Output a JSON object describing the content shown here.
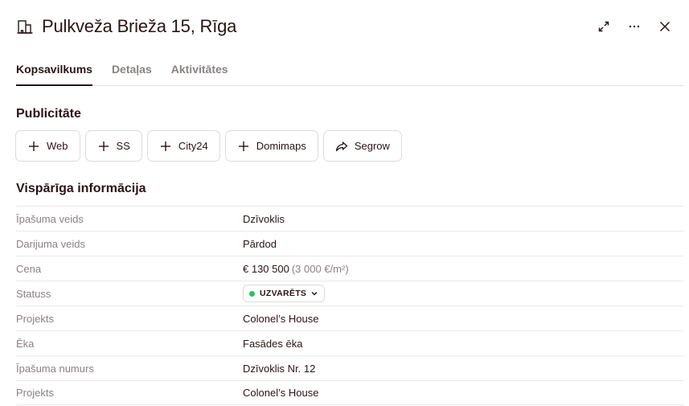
{
  "header": {
    "title": "Pulkveža Brieža 15, Rīga",
    "title_icon": "building-icon",
    "actions": [
      "expand-icon",
      "more-icon",
      "close-icon"
    ]
  },
  "tabs": [
    {
      "label": "Kopsavilkums",
      "active": true
    },
    {
      "label": "Detaļas",
      "active": false
    },
    {
      "label": "Aktivitātes",
      "active": false
    }
  ],
  "publicity": {
    "title": "Publicitāte",
    "buttons": [
      {
        "label": "Web",
        "icon": "plus-icon"
      },
      {
        "label": "SS",
        "icon": "plus-icon"
      },
      {
        "label": "City24",
        "icon": "plus-icon"
      },
      {
        "label": "Domimaps",
        "icon": "plus-icon"
      },
      {
        "label": "Segrow",
        "icon": "share-icon"
      }
    ]
  },
  "info": {
    "title": "Vispārīga informācija",
    "rows": [
      {
        "label": "Īpašuma veids",
        "value": "Dzīvoklis"
      },
      {
        "label": "Darijuma veids",
        "value": "Pārdod"
      },
      {
        "label": "Cena",
        "value": "€ 130 500",
        "sub": "(3 000 €/m²)"
      },
      {
        "label": "Statuss",
        "value": "UZVARĒTS",
        "status_color": "#22c55e"
      },
      {
        "label": "Projekts",
        "value": "Colonel’s House"
      },
      {
        "label": "Ēka",
        "value": "Fasādes ēka"
      },
      {
        "label": "Īpašuma numurs",
        "value": "Dzīvoklis Nr. 12"
      },
      {
        "label": "Projekts",
        "value": "Colonel’s House"
      }
    ]
  }
}
